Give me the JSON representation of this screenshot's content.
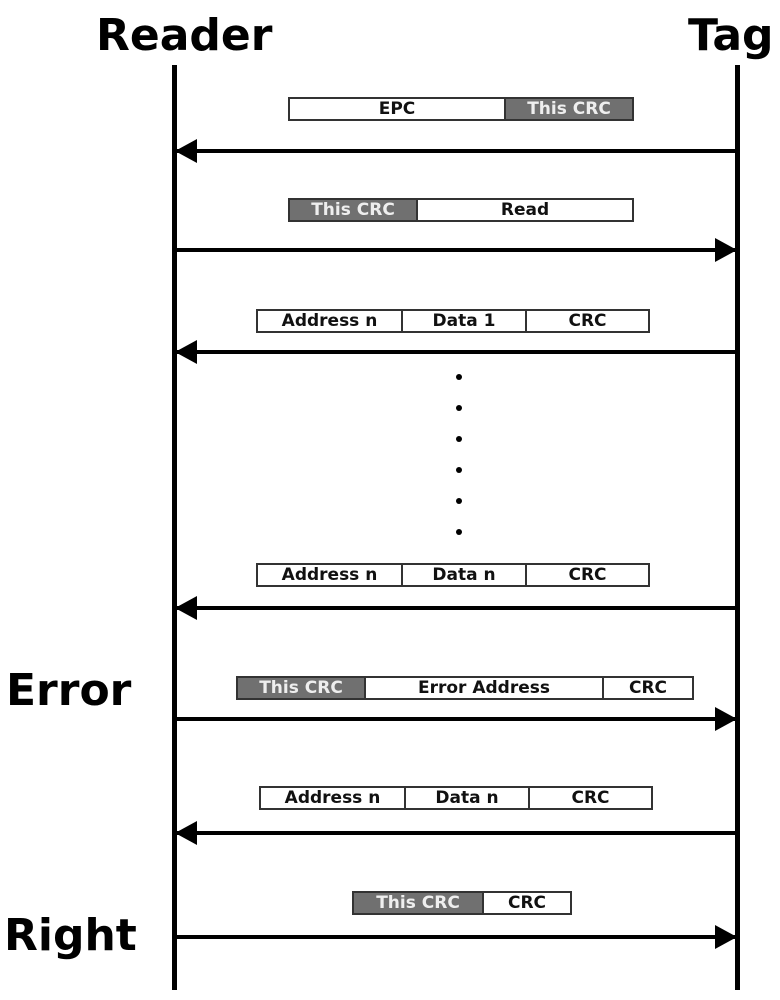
{
  "reader_label": "Reader",
  "tag_label": "Tag",
  "error_label": "Error",
  "right_label": "Right",
  "messages": [
    {
      "dir": "left",
      "fields": [
        {
          "t": "EPC",
          "dark": false
        },
        {
          "t": "This CRC",
          "dark": true
        }
      ]
    },
    {
      "dir": "right",
      "fields": [
        {
          "t": "This CRC",
          "dark": true
        },
        {
          "t": "Read",
          "dark": false
        }
      ]
    },
    {
      "dir": "left",
      "fields": [
        {
          "t": "Address n",
          "dark": false
        },
        {
          "t": "Data 1",
          "dark": false
        },
        {
          "t": "CRC",
          "dark": false
        }
      ]
    },
    {
      "dir": "left",
      "fields": [
        {
          "t": "Address n",
          "dark": false
        },
        {
          "t": "Data n",
          "dark": false
        },
        {
          "t": "CRC",
          "dark": false
        }
      ]
    },
    {
      "dir": "right",
      "fields": [
        {
          "t": "This CRC",
          "dark": true
        },
        {
          "t": "Error Address",
          "dark": false
        },
        {
          "t": "CRC",
          "dark": false
        }
      ]
    },
    {
      "dir": "left",
      "fields": [
        {
          "t": "Address n",
          "dark": false
        },
        {
          "t": "Data n",
          "dark": false
        },
        {
          "t": "CRC",
          "dark": false
        }
      ]
    },
    {
      "dir": "right",
      "fields": [
        {
          "t": "This CRC",
          "dark": true
        },
        {
          "t": "CRC",
          "dark": false
        }
      ]
    }
  ]
}
